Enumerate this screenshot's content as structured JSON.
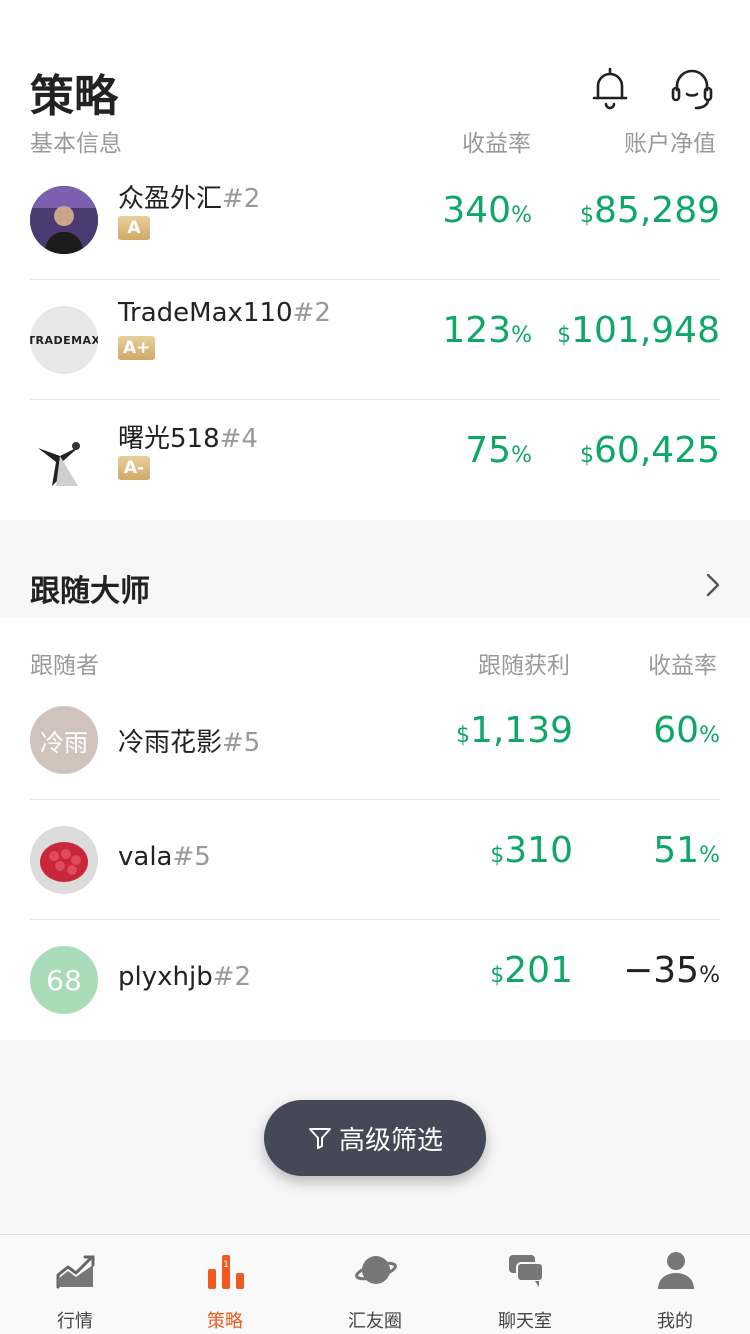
{
  "header": {
    "title": "策略",
    "col_basic": "基本信息",
    "col_return": "收益率",
    "col_equity": "账户净值"
  },
  "strategies": [
    {
      "name": "众盈外汇",
      "rank": "#2",
      "grade": "A",
      "return_value": "340",
      "return_unit": "%",
      "equity_symbol": "$",
      "equity_value": "85,289"
    },
    {
      "name": "TradeMax110",
      "rank": "#2",
      "grade": "A+",
      "return_value": "123",
      "return_unit": "%",
      "equity_symbol": "$",
      "equity_value": "101,948",
      "avatar_text": "TRADEMAX"
    },
    {
      "name": "曙光518",
      "rank": "#4",
      "grade": "A-",
      "return_value": "75",
      "return_unit": "%",
      "equity_symbol": "$",
      "equity_value": "60,425"
    }
  ],
  "follow_section": {
    "title": "跟随大师",
    "col_follower": "跟随者",
    "col_profit": "跟随获利",
    "col_return": "收益率"
  },
  "followers": [
    {
      "name": "冷雨花影",
      "rank": "#5",
      "avatar_text": "冷雨",
      "profit_symbol": "$",
      "profit_value": "1,139",
      "return_value": "60",
      "return_unit": "%"
    },
    {
      "name": "vala",
      "rank": "#5",
      "profit_symbol": "$",
      "profit_value": "310",
      "return_value": "51",
      "return_unit": "%"
    },
    {
      "name": "plyxhjb",
      "rank": "#2",
      "avatar_text": "68",
      "profit_symbol": "$",
      "profit_value": "201",
      "return_value": "−35",
      "return_unit": "%"
    }
  ],
  "filter_button": "高级筛选",
  "tabs": [
    {
      "label": "行情",
      "icon": "chart-icon"
    },
    {
      "label": "策略",
      "icon": "strategy-icon",
      "active": true
    },
    {
      "label": "汇友圈",
      "icon": "planet-icon"
    },
    {
      "label": "聊天室",
      "icon": "chat-icon"
    },
    {
      "label": "我的",
      "icon": "user-icon"
    }
  ],
  "colors": {
    "green": "#0fa768",
    "accent": "#f05a1e",
    "button": "#454856"
  }
}
